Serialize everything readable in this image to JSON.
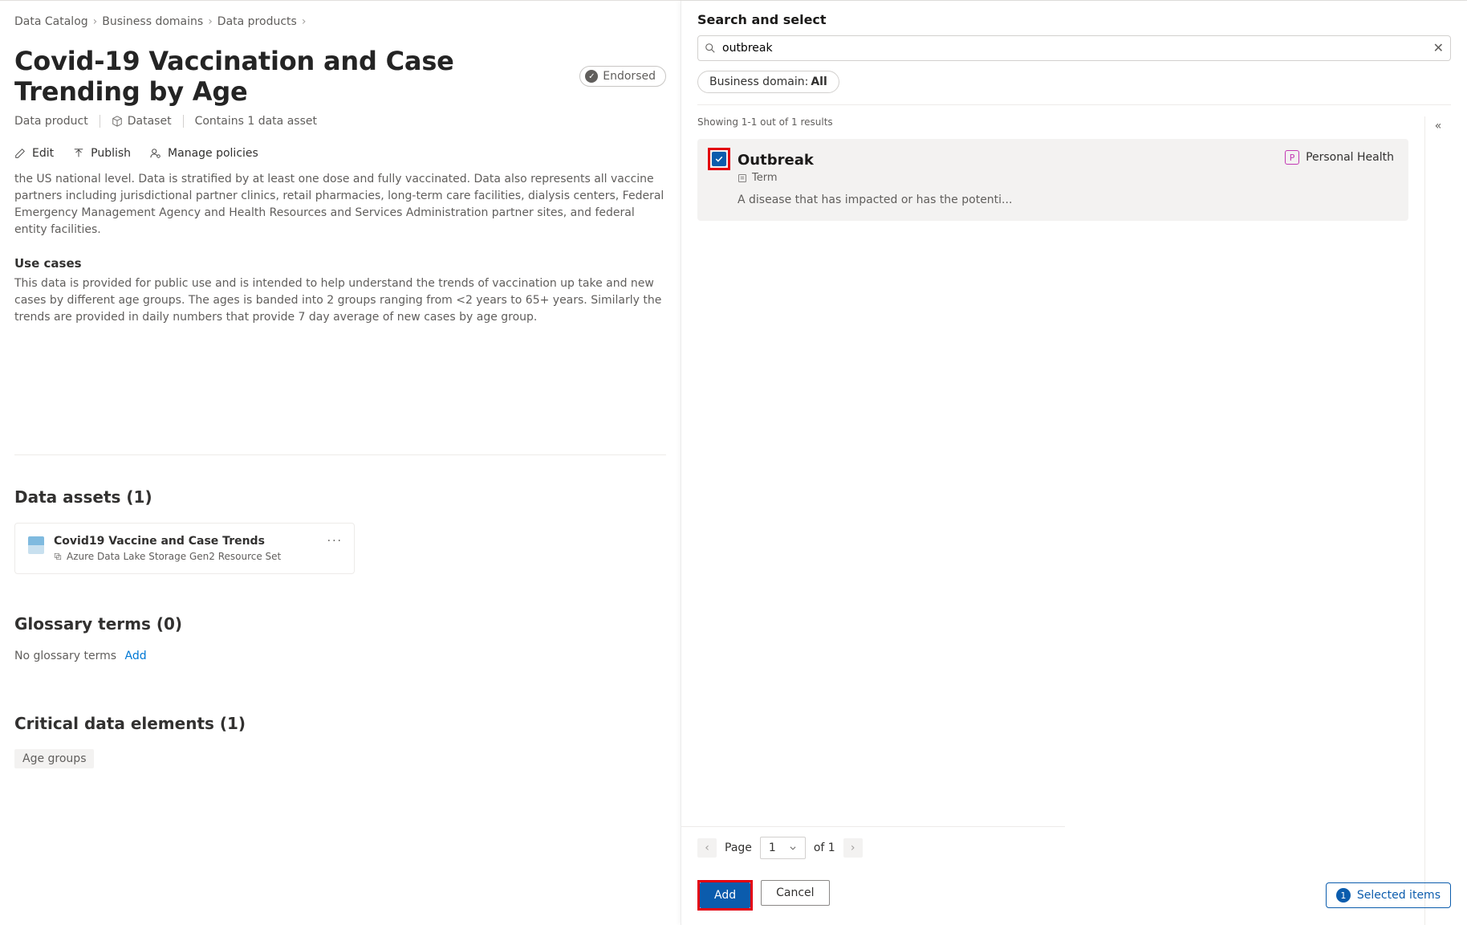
{
  "breadcrumb": [
    "Data Catalog",
    "Business domains",
    "Data products"
  ],
  "page_title": "Covid-19 Vaccination and Case Trending by Age",
  "endorsed_label": "Endorsed",
  "meta": {
    "type": "Data product",
    "dataset_label": "Dataset",
    "contains": "Contains 1 data asset"
  },
  "toolbar": {
    "edit": "Edit",
    "publish": "Publish",
    "manage_policies": "Manage policies"
  },
  "description_partial": "the US national level. Data is stratified by at least one dose and fully vaccinated. Data also represents all vaccine partners including jurisdictional partner clinics, retail pharmacies, long-term care facilities, dialysis centers, Federal Emergency Management Agency and Health Resources and Services Administration partner sites, and federal entity facilities.",
  "use_cases_heading": "Use cases",
  "use_cases_text": "This data is provided for public use and is intended to help understand the trends of vaccination up take and new cases by different age groups.  The ages is banded into 2 groups ranging from <2 years to 65+ years.  Similarly the trends are provided in daily numbers that provide 7 day average of new cases by age group.",
  "data_assets": {
    "heading": "Data assets (1)",
    "asset_name": "Covid19 Vaccine and Case Trends",
    "asset_subtype": "Azure Data Lake Storage Gen2 Resource Set"
  },
  "glossary": {
    "heading": "Glossary terms (0)",
    "empty": "No glossary terms",
    "add": "Add"
  },
  "cde": {
    "heading": "Critical data elements (1)",
    "tag": "Age groups"
  },
  "panel": {
    "title": "Search and select",
    "search_value": "outbreak",
    "filter_label": "Business domain:",
    "filter_value": "All",
    "result_count": "Showing 1-1 out of 1 results",
    "result": {
      "title": "Outbreak",
      "type": "Term",
      "desc": "A disease that has impacted or has the potenti...",
      "domain_letter": "P",
      "domain_name": "Personal Health"
    },
    "pager": {
      "label_page": "Page",
      "current": "1",
      "of_label": "of 1"
    },
    "add_btn": "Add",
    "cancel_btn": "Cancel",
    "selected_count": "1",
    "selected_label": "Selected items"
  }
}
